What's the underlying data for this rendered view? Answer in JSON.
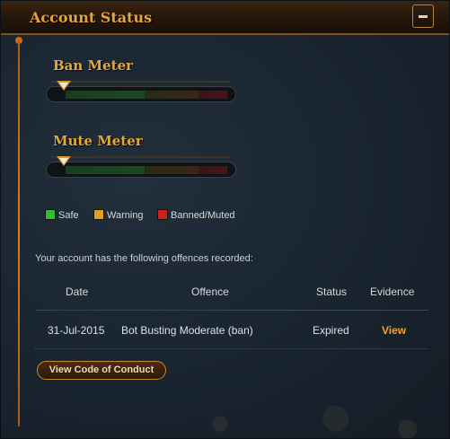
{
  "header": {
    "title": "Account Status"
  },
  "ban_meter": {
    "title": "Ban Meter",
    "level": 0
  },
  "mute_meter": {
    "title": "Mute Meter",
    "level": 0
  },
  "legend": [
    {
      "label": "Safe",
      "color": "#2fbf2f"
    },
    {
      "label": "Warning",
      "color": "#e0a020"
    },
    {
      "label": "Banned/Muted",
      "color": "#d02020"
    }
  ],
  "offences": {
    "notice": "Your account has the following offences recorded:",
    "headers": {
      "date": "Date",
      "offence": "Offence",
      "status": "Status",
      "evidence": "Evidence"
    },
    "rows": [
      {
        "date": "31-Jul-2015",
        "offence": "Bot Busting Moderate (ban)",
        "status": "Expired",
        "evidence": "View"
      }
    ]
  },
  "code_of_conduct_button": "View Code of Conduct",
  "colors": {
    "accent": "#e4a838",
    "link": "#f0a436",
    "background": "#1a2631"
  }
}
